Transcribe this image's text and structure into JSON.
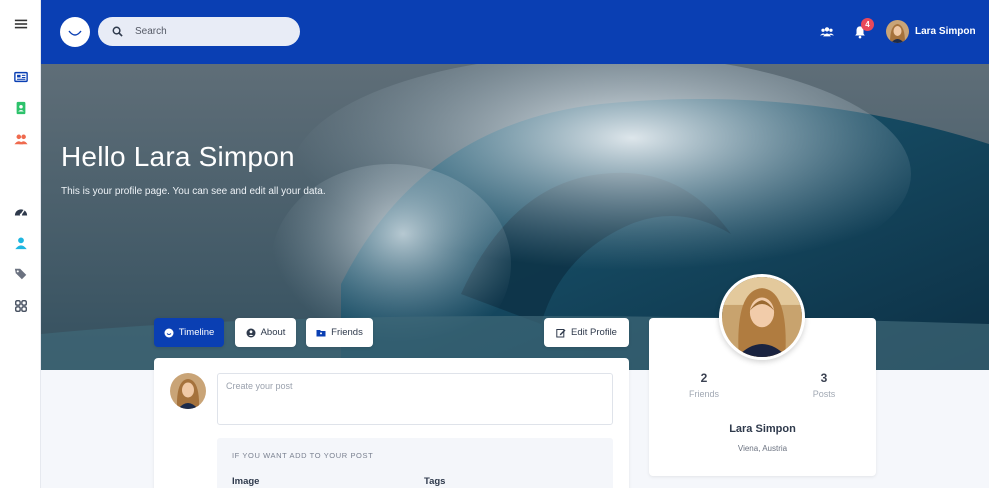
{
  "header": {
    "search_placeholder": "Search",
    "notifications_count": "4",
    "user_name": "Lara Simpon",
    "bg_color": "#0a3fb3"
  },
  "sidebar": {
    "icons": [
      "menu-icon",
      "news-icon",
      "contact-icon",
      "users-icon",
      "dashboard-icon",
      "user-icon",
      "tags-icon",
      "apps-icon"
    ]
  },
  "hero": {
    "title": "Hello Lara Simpon",
    "subtitle": "This is your profile page. You can see and edit all your data."
  },
  "tabs": {
    "timeline": "Timeline",
    "about": "About",
    "friends": "Friends",
    "edit_profile": "Edit Profile"
  },
  "post": {
    "placeholder": "Create your post",
    "add_title": "IF YOU WANT ADD TO YOUR POST",
    "image_label": "Image",
    "tags_label": "Tags"
  },
  "profile": {
    "friends_count": "2",
    "friends_label": "Friends",
    "posts_count": "3",
    "posts_label": "Posts",
    "name": "Lara Simpon",
    "location": "Viena, Austria"
  }
}
